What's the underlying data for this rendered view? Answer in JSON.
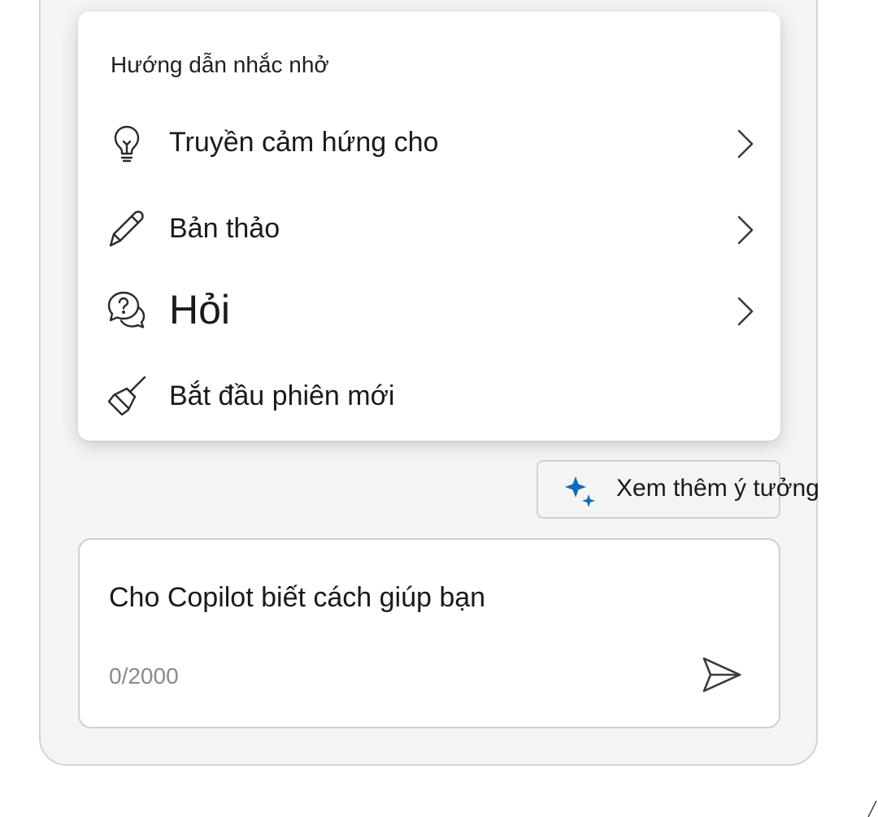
{
  "menu": {
    "heading": "Hướng dẫn nhắc nhở",
    "items": [
      {
        "label": "Truyền cảm hứng cho",
        "icon": "lightbulb-icon",
        "has_submenu": true
      },
      {
        "label": "Bản thảo",
        "icon": "pencil-icon",
        "has_submenu": true
      },
      {
        "label": "Hỏi",
        "icon": "chat-question-icon",
        "has_submenu": true
      },
      {
        "label": "Bắt đầu phiên mới",
        "icon": "broom-icon",
        "has_submenu": false
      }
    ]
  },
  "ideas_button": {
    "label": "Xem thêm ý tưởng",
    "icon": "sparkle-icon",
    "icon_color": "#0f6cbd"
  },
  "composer": {
    "placeholder": "Cho Copilot biết cách giúp bạn",
    "value": "",
    "char_count": "0/2000",
    "send_icon": "send-icon"
  },
  "colors": {
    "pane_background": "#f4f4f4",
    "accent": "#0f6cbd",
    "text": "#1a1a1a",
    "muted_text": "#8a8a8a"
  }
}
